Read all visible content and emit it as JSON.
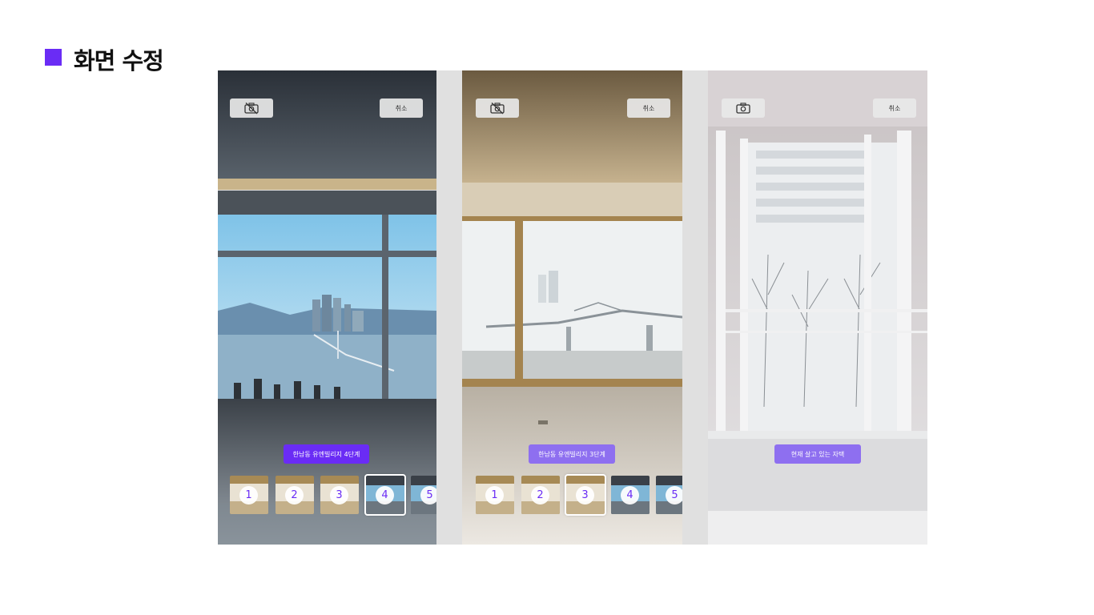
{
  "page": {
    "title": "화면 수정",
    "accent_color": "#6a2cf5"
  },
  "screens": [
    {
      "camera_icon": "camera-off-icon",
      "cancel_label": "취소",
      "label": "한남동 유엔빌리지 4단계",
      "label_color": "#6a2cf5",
      "thumbnails": [
        {
          "num": "1"
        },
        {
          "num": "2"
        },
        {
          "num": "3"
        },
        {
          "num": "4"
        },
        {
          "num": "5"
        }
      ],
      "selected_thumbnail": "4"
    },
    {
      "camera_icon": "camera-off-icon",
      "cancel_label": "취소",
      "label": "한남동 유엔빌리지 3단계",
      "label_color": "#8e6ff0",
      "thumbnails": [
        {
          "num": "1"
        },
        {
          "num": "2"
        },
        {
          "num": "3"
        },
        {
          "num": "4"
        },
        {
          "num": "5"
        }
      ],
      "selected_thumbnail": "3"
    },
    {
      "camera_icon": "camera-icon",
      "cancel_label": "취소",
      "label": "현재 살고 있는 자택",
      "label_color": "#8e6ff0"
    }
  ]
}
